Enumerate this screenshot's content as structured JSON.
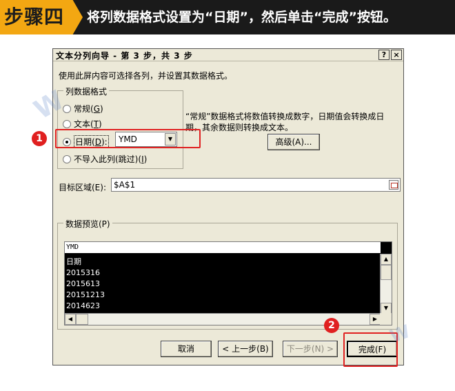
{
  "banner": {
    "step_label": "步骤四",
    "instruction": "将列数据格式设置为“日期”，然后单击“完成”按钮。"
  },
  "dialog": {
    "title": "文本分列向导 - 第 3 步，共 3 步",
    "help_button": "?",
    "close_button": "×",
    "description": "使用此屏内容可选择各列，并设置其数据格式。",
    "column_format": {
      "legend": "列数据格式",
      "options": [
        {
          "label": "常规",
          "hotkey": "G",
          "checked": false
        },
        {
          "label": "文本",
          "hotkey": "T",
          "checked": false
        },
        {
          "label": "日期",
          "hotkey": "D",
          "checked": true
        },
        {
          "label": "不导入此列(跳过)",
          "hotkey": "I",
          "checked": false
        }
      ],
      "date_format_value": "YMD"
    },
    "note_line1": "“常规”数据格式将数值转换成数字，日期值会转换成日",
    "note_line2": "期，其余数据则转换成文本。",
    "advanced_button": "高级(A)...",
    "target_label": "目标区域(E):",
    "target_value": "$A$1",
    "preview": {
      "legend": "数据预览(P)",
      "header": "YMD",
      "rows": [
        "日期",
        "2015316",
        "2015613",
        "20151213",
        "2014623"
      ]
    },
    "buttons": {
      "cancel": "取消",
      "back": "< 上一步(B)",
      "next": "下一步(N) >",
      "finish": "完成(F)"
    }
  },
  "annotations": {
    "badge1": "1",
    "badge2": "2"
  },
  "colors": {
    "banner_bg": "#1a1a1a",
    "step_tag": "#f3a712",
    "highlight": "#e02020",
    "dialog_bg": "#ece9d8"
  }
}
